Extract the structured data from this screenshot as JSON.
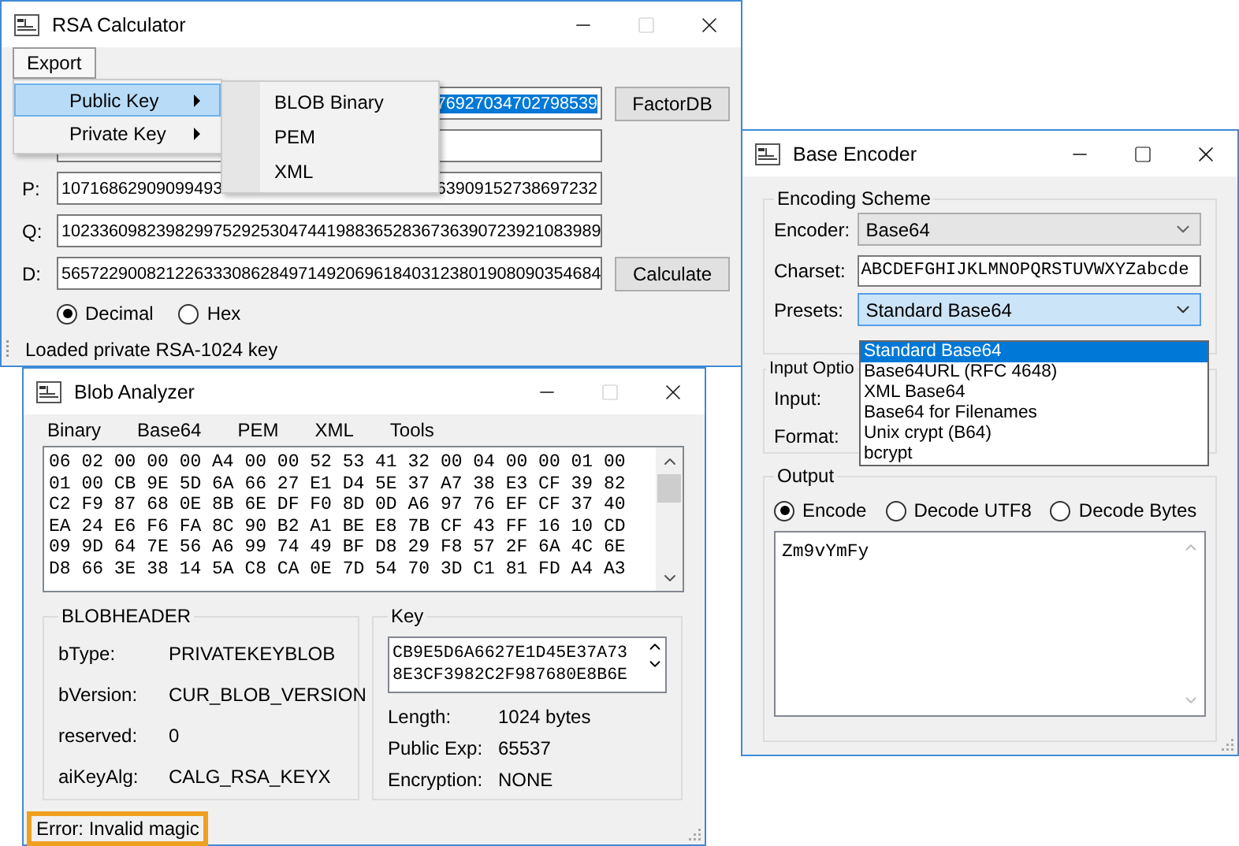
{
  "rsa_calculator": {
    "title": "RSA Calculator",
    "can_maximize": false,
    "menu": [
      {
        "label": "Export",
        "open": true
      }
    ],
    "export_menu": [
      {
        "label": "Public Key",
        "selected": true
      },
      {
        "label": "Private Key",
        "selected": false
      }
    ],
    "submenu": [
      "BLOB Binary",
      "PEM",
      "XML"
    ],
    "rows": [
      {
        "kind": "selected",
        "value": "76927034702798539",
        "button": "FactorDB"
      },
      {
        "kind": "empty"
      },
      {
        "kind": "split",
        "label": "P:",
        "value_start": "10716862909099493",
        "value_end": "63909152738697232"
      },
      {
        "kind": "full",
        "label": "Q:",
        "value": "102336098239829975292530474419883652836736390723921083989"
      },
      {
        "kind": "full",
        "label": "D:",
        "value": "565722900821226333086284971492069618403123801908090354684",
        "button": "Calculate"
      }
    ],
    "number_format": [
      {
        "label": "Decimal",
        "selected": true
      },
      {
        "label": "Hex",
        "selected": false
      }
    ],
    "status": "Loaded private RSA-1024 key"
  },
  "blob_analyzer": {
    "title": "Blob Analyzer",
    "can_maximize": false,
    "menu": [
      "Binary",
      "Base64",
      "PEM",
      "XML",
      "Tools"
    ],
    "hex_lines": [
      "06 02 00 00 00 A4 00 00 52 53 41 32 00 04 00 00 01 00",
      "01 00 CB 9E 5D 6A 66 27 E1 D4 5E 37 A7 38 E3 CF 39 82",
      "C2 F9 87 68 0E 8B 6E DF F0 8D 0D A6 97 76 EF CF 37 40",
      "EA 24 E6 F6 FA 8C 90 B2 A1 BE E8 7B CF 43 FF 16 10 CD",
      "09 9D 64 7E 56 A6 99 74 49 BF D8 29 F8 57 2F 6A 4C 6E",
      "D8 66 3E 38 14 5A C8 CA 0E 7D 54 70 3D C1 81 FD A4 A3"
    ],
    "blobheader": {
      "title": "BLOBHEADER",
      "fields": [
        {
          "label": "bType:",
          "value": "PRIVATEKEYBLOB"
        },
        {
          "label": "bVersion:",
          "value": "CUR_BLOB_VERSION"
        },
        {
          "label": "reserved:",
          "value": "0"
        },
        {
          "label": "aiKeyAlg:",
          "value": "CALG_RSA_KEYX"
        }
      ]
    },
    "key": {
      "title": "Key",
      "lines": [
        "CB9E5D6A6627E1D45E37A73",
        "8E3CF3982C2F987680E8B6E"
      ],
      "fields": [
        {
          "label": "Length:",
          "value": "1024 bytes"
        },
        {
          "label": "Public Exp:",
          "value": "65537"
        },
        {
          "label": "Encryption:",
          "value": "NONE"
        }
      ]
    },
    "status": {
      "text": "Error: Invalid magic",
      "highlighted": true
    }
  },
  "base_encoder": {
    "title": "Base Encoder",
    "can_maximize": true,
    "encoding_scheme": {
      "title": "Encoding Scheme",
      "encoder_label": "Encoder:",
      "encoder": "Base64",
      "charset_label": "Charset:",
      "charset": "ABCDEFGHIJKLMNOPQRSTUVWXYZabcde",
      "presets_label": "Presets:",
      "preset": "Standard Base64",
      "preset_options": [
        {
          "label": "Standard Base64",
          "selected": true
        },
        {
          "label": "Base64URL (RFC 4648)",
          "selected": false
        },
        {
          "label": "XML Base64",
          "selected": false
        },
        {
          "label": "Base64 for Filenames",
          "selected": false
        },
        {
          "label": "Unix crypt (B64)",
          "selected": false
        },
        {
          "label": "bcrypt",
          "selected": false
        }
      ]
    },
    "input_options": {
      "title": "Input Optio",
      "labels": [
        "Input:",
        "Format:"
      ]
    },
    "output": {
      "title": "Output",
      "modes": [
        {
          "label": "Encode",
          "selected": true
        },
        {
          "label": "Decode UTF8",
          "selected": false
        },
        {
          "label": "Decode Bytes",
          "selected": false
        }
      ],
      "text": "Zm9vYmFy"
    }
  }
}
